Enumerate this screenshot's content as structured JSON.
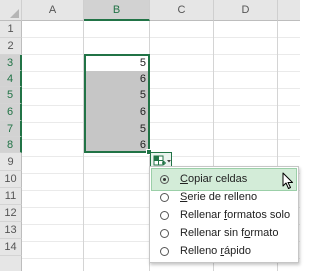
{
  "columns": [
    "A",
    "B",
    "C",
    "D"
  ],
  "rows": [
    "1",
    "2",
    "3",
    "4",
    "5",
    "6",
    "7",
    "8",
    "9",
    "10",
    "11",
    "12",
    "13",
    "14"
  ],
  "cells": {
    "B3": "5",
    "B4": "6",
    "B5": "5",
    "B6": "6",
    "B7": "5",
    "B8": "6"
  },
  "autofill_menu": {
    "button_icon": "autofill-options-icon",
    "selected_index": 0,
    "items": [
      {
        "pre": "",
        "key": "C",
        "post": "opiar celdas"
      },
      {
        "pre": "",
        "key": "S",
        "post": "erie de relleno"
      },
      {
        "pre": "Rellenar ",
        "key": "f",
        "post": "ormatos solo"
      },
      {
        "pre": "Rellenar sin f",
        "key": "o",
        "post": "rmato"
      },
      {
        "pre": "Relleno ",
        "key": "r",
        "post": "ápido"
      }
    ]
  },
  "colors": {
    "accent": "#217346",
    "selection": "#c6c6c6",
    "menu_highlight": "#d3ecd8"
  }
}
